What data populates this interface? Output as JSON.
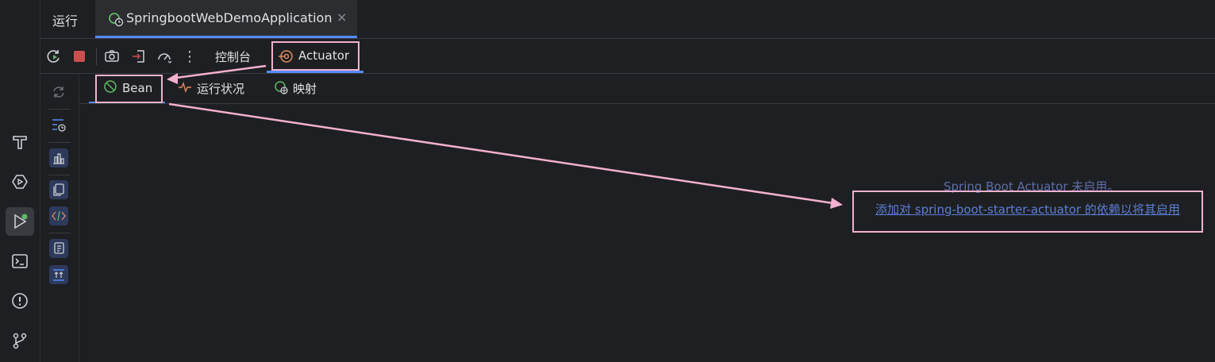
{
  "header": {
    "run_title": "运行",
    "run_config_tab": "SpringbootWebDemoApplication",
    "close_glyph": "×"
  },
  "toolbar": {
    "console_tab": "控制台",
    "actuator_tab": "Actuator",
    "more_glyph": "⋮"
  },
  "actuator_tabs": [
    {
      "label": "Bean",
      "icon": "bean-icon"
    },
    {
      "label": "运行状况",
      "icon": "health-icon"
    },
    {
      "label": "映射",
      "icon": "mappings-icon"
    }
  ],
  "message": {
    "line1": "Spring Boot Actuator 未启用。",
    "link": "添加对 spring-boot-starter-actuator 的依赖以将其启用"
  },
  "colors": {
    "accent": "#548af7",
    "annotation": "#f4b1cf",
    "spring_green": "#5fb865"
  }
}
